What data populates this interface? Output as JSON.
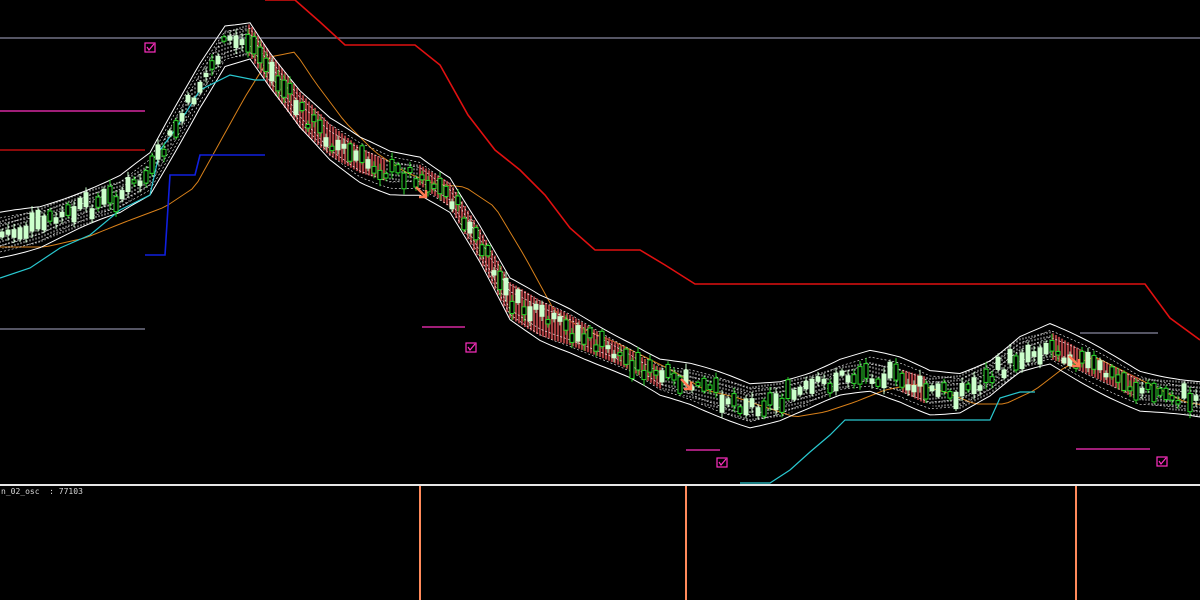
{
  "indicator_window": {
    "label": "n_02_osc  : 77103",
    "signal_lines": [
      420,
      686,
      1076
    ],
    "colors": {
      "signal": "#ff8a5b",
      "separator": "#e6e6e6",
      "label": "#d8d8d8"
    }
  },
  "colors": {
    "background": "#000000",
    "bull_candle": "#ccffcc",
    "bear_candle": "#2bd62b",
    "band_white": "#ffffff",
    "band_hatch_bull": "#e8e8e8",
    "band_hatch_bear": "#c0484a",
    "red_step": "#e01010",
    "orange_line": "#d8801a",
    "cyan_line": "#29c8d0",
    "blue_line": "#1020e0",
    "magenta": "#ff30c0",
    "level_line": "#8888a0",
    "arrow": "#ff7a52"
  },
  "chart_data": {
    "type": "line",
    "description_free": true,
    "series": [
      {
        "role": "mid-band",
        "x": [
          0,
          40,
          80,
          120,
          150,
          175,
          200,
          225,
          250,
          270,
          300,
          330,
          360,
          390,
          420,
          450,
          480,
          510,
          540,
          570,
          600,
          630,
          660,
          690,
          720,
          750,
          780,
          810,
          840,
          870,
          900,
          930,
          960,
          990,
          1020,
          1050,
          1080,
          1110,
          1140,
          1170,
          1200
        ],
        "y": [
          235,
          226,
          210,
          195,
          175,
          130,
          85,
          45,
          40,
          70,
          110,
          140,
          160,
          172,
          175,
          195,
          245,
          300,
          318,
          330,
          345,
          360,
          378,
          385,
          395,
          405,
          400,
          390,
          378,
          372,
          380,
          392,
          392,
          378,
          355,
          345,
          360,
          375,
          390,
          395,
          400
        ]
      },
      {
        "role": "red-step",
        "x": [
          265,
          295,
          320,
          345,
          415,
          440,
          468,
          495,
          520,
          545,
          570,
          595,
          640,
          665,
          695,
          1145,
          1170,
          1200
        ],
        "y": [
          0,
          0,
          22,
          45,
          45,
          65,
          115,
          150,
          170,
          195,
          228,
          250,
          250,
          265,
          284,
          284,
          318,
          340
        ]
      },
      {
        "role": "cyan-support",
        "x": [
          0,
          30,
          60,
          90,
          120,
          150,
          160,
          175,
          200,
          230,
          255,
          265
        ],
        "y": [
          278,
          268,
          248,
          235,
          210,
          195,
          150,
          130,
          90,
          75,
          80,
          80
        ]
      },
      {
        "role": "cyan-support-2",
        "x": [
          740,
          770,
          790,
          810,
          830,
          845,
          990,
          1000,
          1020,
          1035
        ],
        "y": [
          483,
          483,
          470,
          452,
          435,
          420,
          420,
          398,
          392,
          392
        ]
      },
      {
        "role": "blue-step",
        "x": [
          145,
          165,
          170,
          195,
          200,
          265
        ],
        "y": [
          255,
          255,
          175,
          175,
          155,
          155
        ]
      }
    ],
    "levels": [
      {
        "y": 38,
        "x1": 0,
        "x2": 1200,
        "color": "level"
      },
      {
        "y": 111,
        "x1": 0,
        "x2": 145,
        "color": "magenta"
      },
      {
        "y": 150,
        "x1": 0,
        "x2": 145,
        "color": "red"
      },
      {
        "y": 329,
        "x1": 0,
        "x2": 145,
        "color": "level"
      },
      {
        "y": 327,
        "x1": 422,
        "x2": 465,
        "color": "magenta"
      },
      {
        "y": 450,
        "x1": 686,
        "x2": 720,
        "color": "magenta"
      },
      {
        "y": 449,
        "x1": 1076,
        "x2": 1150,
        "color": "magenta"
      },
      {
        "y": 333,
        "x1": 1080,
        "x2": 1158,
        "color": "level"
      }
    ],
    "check_marks": [
      {
        "x": 150,
        "y": 48
      },
      {
        "x": 471,
        "y": 348
      },
      {
        "x": 722,
        "y": 463
      },
      {
        "x": 1162,
        "y": 462
      }
    ],
    "down_arrows": [
      {
        "x": 421,
        "y": 193
      },
      {
        "x": 686,
        "y": 385
      },
      {
        "x": 1074,
        "y": 362
      }
    ]
  }
}
